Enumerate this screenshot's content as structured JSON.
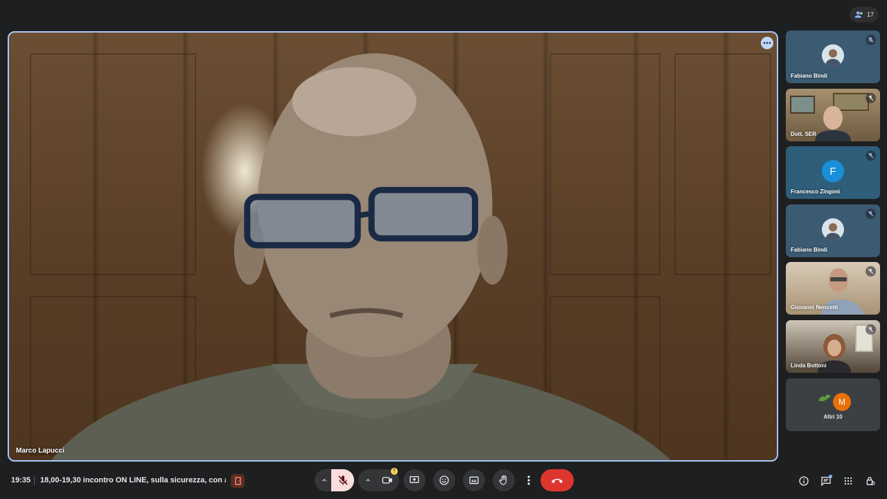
{
  "participants_count": "17",
  "main_speaker": {
    "name": "Marco Lapucci"
  },
  "tiles": [
    {
      "name": "Fabiano Bindi",
      "kind": "avatar-photo",
      "bg": "#3b5b72"
    },
    {
      "name": "Dott. SER",
      "kind": "video",
      "bg": "#8a7556"
    },
    {
      "name": "Francesco Zingoni",
      "kind": "initial",
      "initial": "F",
      "bg": "#2e5e7a",
      "avatar_color": "#1a8fd9"
    },
    {
      "name": "Fabiano Bindi",
      "kind": "avatar-photo",
      "bg": "#3b5b72"
    },
    {
      "name": "Giovanni Nencetti",
      "kind": "video",
      "bg": "#b9a48a"
    },
    {
      "name": "Linda Bottoni",
      "kind": "video",
      "bg": "#6e6253"
    }
  ],
  "others": {
    "label": "Altri 10",
    "initial": "M",
    "avatar_color": "#e8710a"
  },
  "bottom": {
    "time": "19:35",
    "meeting_title": "18,00-19,30 incontro ON LINE, sulla sicurezza, con a..."
  },
  "colors": {
    "end_call": "#dc362e",
    "active_border": "#a8c7fa",
    "mic_off_bg": "#f9dedc"
  },
  "icons": {
    "controls": [
      "chevron-up-icon",
      "mic-off-icon",
      "chevron-up-icon",
      "camera-icon",
      "present-icon",
      "emoji-icon",
      "captions-icon",
      "raise-hand-icon",
      "more-vert-icon",
      "call-end-icon"
    ],
    "right": [
      "info-icon",
      "chat-icon",
      "activities-icon",
      "lock-icon"
    ]
  }
}
